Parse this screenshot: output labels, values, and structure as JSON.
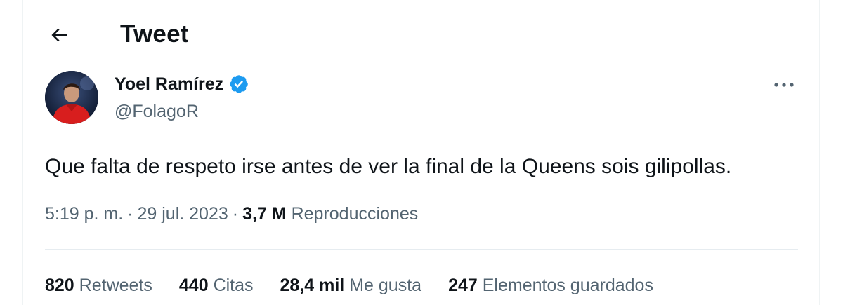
{
  "header": {
    "title": "Tweet",
    "back_icon": "arrow-left-icon"
  },
  "author": {
    "name": "Yoel Ramírez",
    "handle": "@FolagoR",
    "verified": true,
    "verified_color": "#1d9bf0"
  },
  "tweet": {
    "text": "Que falta de respeto irse antes de ver la final de la Queens sois gilipollas.",
    "time": "5:19 p. m.",
    "separator": "·",
    "date": "29 jul. 2023",
    "views_count": "3,7 M",
    "views_label": "Reproducciones"
  },
  "stats": [
    {
      "count": "820",
      "label": "Retweets"
    },
    {
      "count": "440",
      "label": "Citas"
    },
    {
      "count": "28,4 mil",
      "label": "Me gusta"
    },
    {
      "count": "247",
      "label": "Elementos guardados"
    }
  ],
  "colors": {
    "text_primary": "#0f1419",
    "text_secondary": "#536471",
    "divider": "#eff3f4",
    "accent": "#1d9bf0"
  }
}
